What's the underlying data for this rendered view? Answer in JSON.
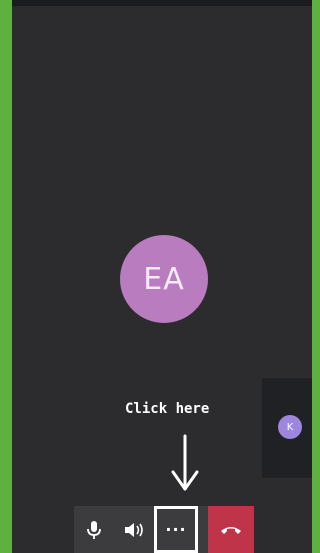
{
  "call": {
    "main_participant_initials": "EA",
    "side_participant_initial": "K"
  },
  "annotation": {
    "text": "Click here"
  },
  "controls": {
    "more_label": "···",
    "icons": [
      "microphone-icon",
      "speaker-icon",
      "more-options-icon",
      "hang-up-icon"
    ]
  },
  "colors": {
    "frame_green": "#5fb13f",
    "stage_bg": "#2c2c2e",
    "main_avatar": "#b97cbf",
    "side_avatar": "#9c86de",
    "hangup_red": "#c0344a"
  }
}
